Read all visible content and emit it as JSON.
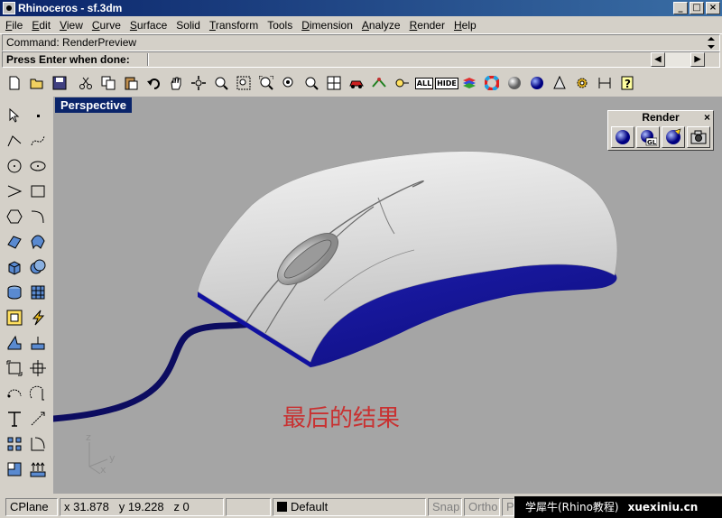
{
  "window": {
    "title": "Rhinoceros - sf.3dm",
    "controls": {
      "minimize": "_",
      "maximize": "□",
      "close": "×"
    }
  },
  "menu": [
    {
      "key": "F",
      "rest": "ile"
    },
    {
      "key": "E",
      "rest": "dit"
    },
    {
      "key": "V",
      "rest": "iew"
    },
    {
      "key": "C",
      "rest": "urve"
    },
    {
      "key": "S",
      "rest": "urface"
    },
    {
      "key": "",
      "rest": "Solid"
    },
    {
      "key": "T",
      "rest": "ransform"
    },
    {
      "key": "",
      "rest": "Tools"
    },
    {
      "key": "D",
      "rest": "imension"
    },
    {
      "key": "A",
      "rest": "nalyze"
    },
    {
      "key": "R",
      "rest": "ender"
    },
    {
      "key": "H",
      "rest": "elp"
    }
  ],
  "command": {
    "history": "Command: RenderPreview",
    "prompt": "Press Enter when done:"
  },
  "toolbar": {
    "all_label": "ALL",
    "hide_label": "HIDE"
  },
  "viewport": {
    "title": "Perspective",
    "axes": {
      "x": "x",
      "y": "y",
      "z": "z"
    }
  },
  "caption": "最后的结果",
  "render_panel": {
    "title": "Render",
    "close": "×",
    "gl_label": "GL"
  },
  "status": {
    "cplane": "CPlane",
    "x": "x 31.878",
    "y": "y 19.228",
    "z": "z 0",
    "layer": "Default",
    "snap": "Snap",
    "ortho": "Ortho",
    "planar": "P"
  },
  "watermark": {
    "left": "学犀牛(Rhino教程)",
    "right": "xuexiniu.cn"
  },
  "colors": {
    "title_bar": "#0a246a",
    "mouse_body": "#d8d8d8",
    "mouse_base": "#1a1aa8",
    "cable": "#0c0c60",
    "viewport_bg": "#a5a5a5",
    "caption": "#c83232"
  }
}
